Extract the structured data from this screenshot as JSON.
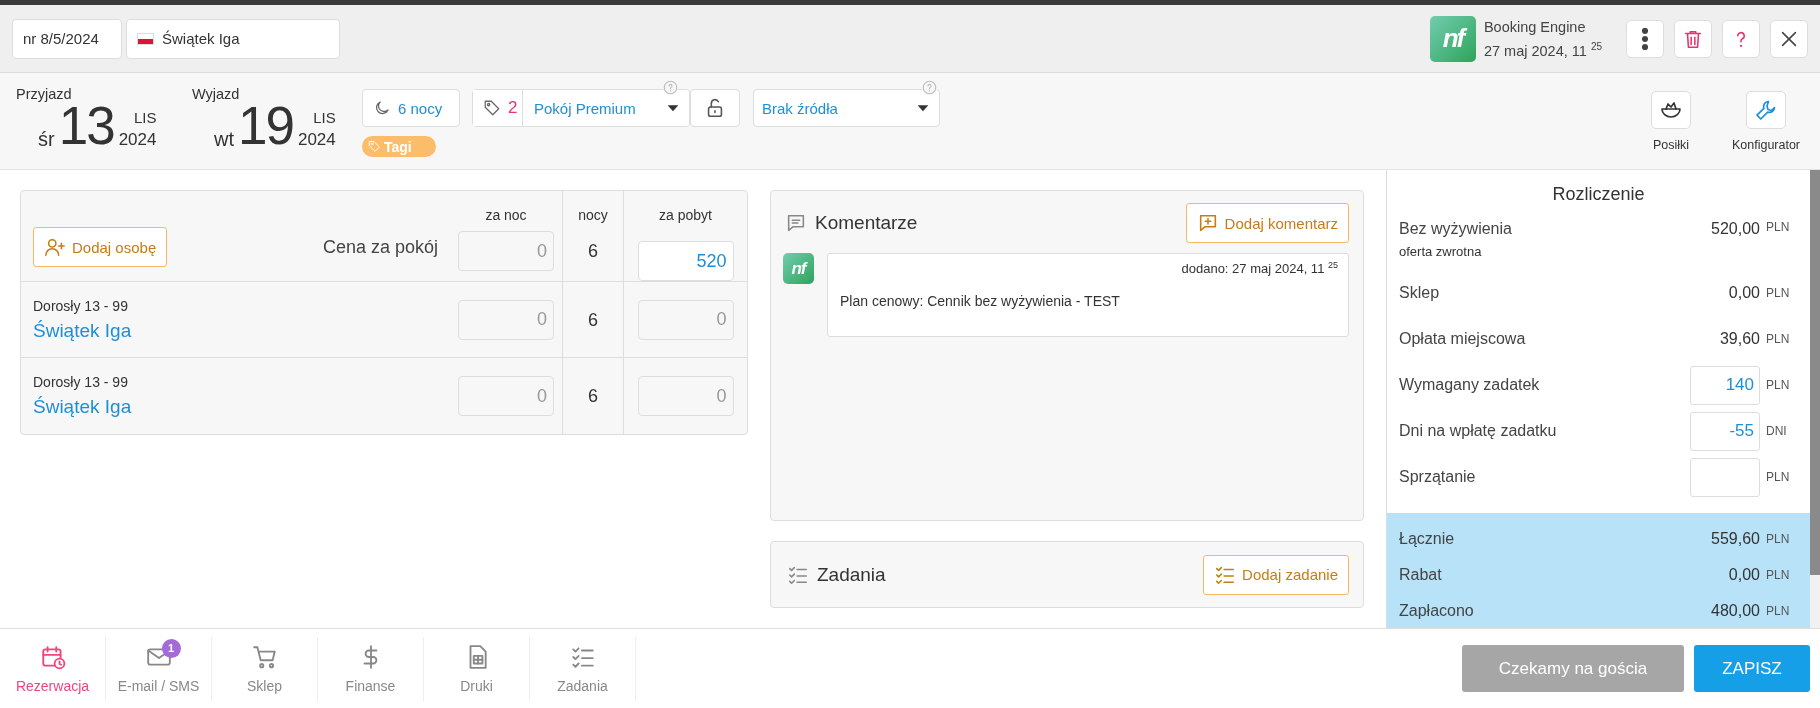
{
  "header": {
    "reservation_no": "nr 8/5/2024",
    "guest": "Świątek Iga",
    "logo_text": "nf",
    "source_name": "Booking Engine",
    "created": "27 maj 2024, 11 $^{25}$"
  },
  "stay": {
    "arrival": {
      "label": "Przyjazd",
      "weekday": "śr",
      "day": "13",
      "month": "LIS",
      "year": "2024"
    },
    "departure": {
      "label": "Wyjazd",
      "weekday": "wt",
      "day": "19",
      "month": "LIS",
      "year": "2024"
    },
    "nights": "6 nocy",
    "tag_count": "2",
    "room": "Pokój Premium",
    "locked": false,
    "source": "Brak źródła",
    "tags_label": "Tagi",
    "tools": [
      {
        "label": "Posiłki",
        "kind": "meals"
      },
      {
        "label": "Konfigurator",
        "kind": "config"
      }
    ]
  },
  "guests": {
    "add_button": "Dodaj osobę",
    "columns": [
      "za noc",
      "nocy",
      "za pobyt"
    ],
    "room_price": {
      "label": "Cena za pokój",
      "per_night": "0",
      "nights": "6",
      "total": "520"
    },
    "rows": [
      {
        "type": "Dorosły 13 - 99",
        "name": "Świątek Iga",
        "per_night": "0",
        "nights": "6",
        "total": "0"
      },
      {
        "type": "Dorosły 13 - 99",
        "name": "Świątek Iga",
        "per_night": "0",
        "nights": "6",
        "total": "0"
      }
    ]
  },
  "comments": {
    "title": "Komentarze",
    "add_button": "Dodaj komentarz",
    "items": [
      {
        "avatar_text": "nf",
        "added": "dodano: 27 maj 2024, 11 $^{25}$",
        "text": "Plan cenowy: Cennik bez wyżywienia - TEST"
      }
    ]
  },
  "tasks": {
    "title": "Zadania",
    "add_button": "Dodaj zadanie"
  },
  "billing": {
    "title": "Rozliczenie",
    "rows": [
      {
        "kind": "amount",
        "label": "Bez wyżywienia",
        "sublabel": "oferta zwrotna",
        "value": "520,00",
        "unit": "PLN"
      },
      {
        "kind": "amount",
        "label": "Sklep",
        "value": "0,00",
        "unit": "PLN"
      },
      {
        "kind": "amount",
        "label": "Opłata miejscowa",
        "value": "39,60",
        "unit": "PLN"
      },
      {
        "kind": "input",
        "label": "Wymagany zadatek",
        "value": "140",
        "unit": "PLN"
      },
      {
        "kind": "input",
        "label": "Dni na wpłatę zadatku",
        "value": "-55",
        "unit": "DNI"
      },
      {
        "kind": "input",
        "label": "Sprzątanie",
        "unit": "PLN"
      }
    ],
    "summary": [
      {
        "label": "Łącznie",
        "value": "559,60",
        "unit": "PLN"
      },
      {
        "label": "Rabat",
        "value": "0,00",
        "unit": "PLN"
      },
      {
        "label": "Zapłacono",
        "value": "480,00",
        "unit": "PLN"
      }
    ]
  },
  "nav": [
    {
      "label": "Rezerwacja",
      "kind": "calendar",
      "selected": true
    },
    {
      "label": "E-mail / SMS",
      "kind": "mail",
      "selected": false,
      "badge": "1"
    },
    {
      "label": "Sklep",
      "kind": "cart",
      "selected": false
    },
    {
      "label": "Finanse",
      "kind": "dollar",
      "selected": false
    },
    {
      "label": "Druki",
      "kind": "document",
      "selected": false
    },
    {
      "label": "Zadania",
      "kind": "checklist",
      "selected": false
    }
  ],
  "actions": [
    {
      "label": "Czekamy na gościa",
      "kind": "secondary"
    },
    {
      "label": "ZAPISZ",
      "kind": "primary"
    }
  ]
}
